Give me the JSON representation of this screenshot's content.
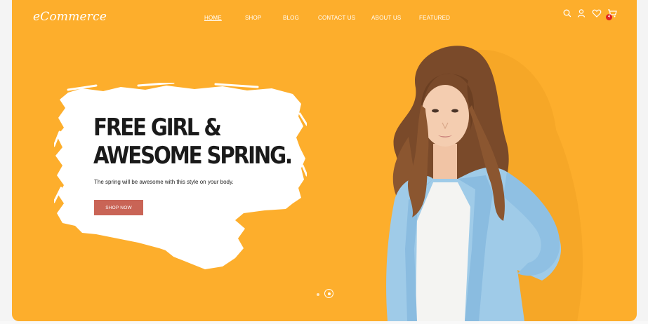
{
  "header": {
    "logo": "eCommerce",
    "nav": [
      {
        "label": "HOME",
        "active": true
      },
      {
        "label": "SHOP"
      },
      {
        "label": "BLOG"
      },
      {
        "label": "CONTACT US"
      },
      {
        "label": "ABOUT US"
      },
      {
        "label": "FEATURED"
      }
    ],
    "icons": [
      "search-icon",
      "user-icon",
      "heart-icon",
      "cart-icon"
    ],
    "cart_badge": "4"
  },
  "hero": {
    "headline_line1": "FREE GIRL &",
    "headline_line2": "AWESOME SPRING.",
    "subtext": "The spring will be awesome with this style on your body.",
    "cta": "SHOP NOW",
    "slides": 2,
    "active_slide": 2
  },
  "colors": {
    "background": "#fdae2c",
    "cta": "#c96456",
    "jacket": "#9fcbe8",
    "badge": "#e02424"
  }
}
